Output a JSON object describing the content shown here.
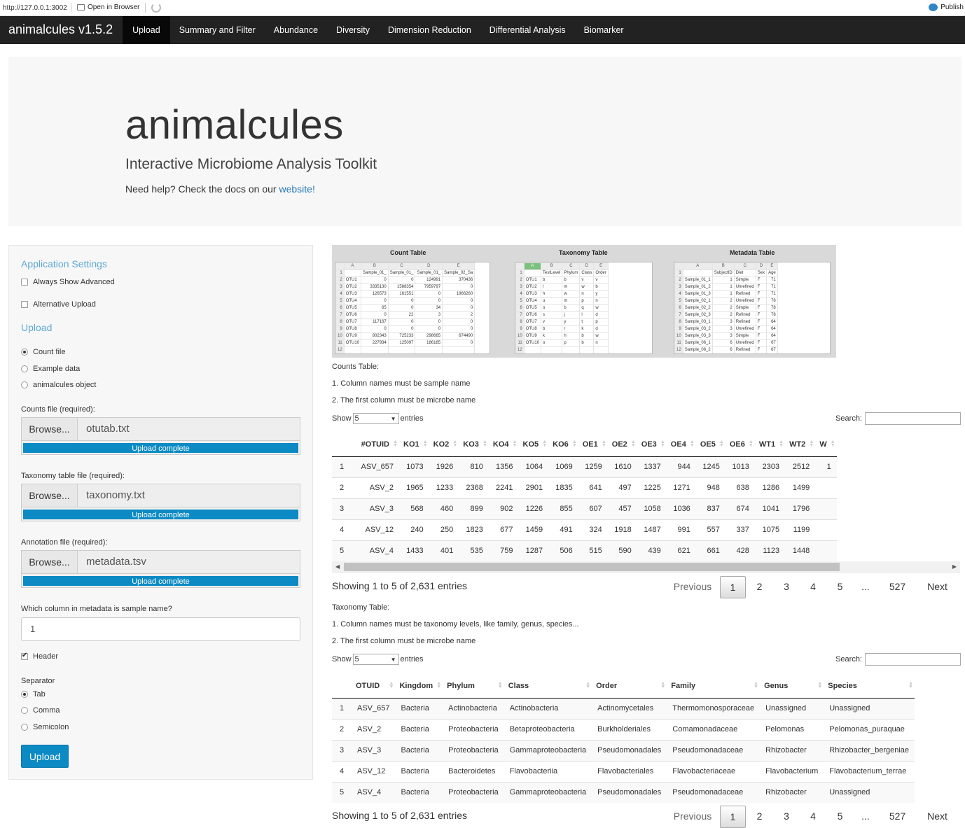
{
  "browser": {
    "url": "http://127.0.0.1:3002",
    "open_in_browser": "Open in Browser",
    "publish": "Publish"
  },
  "navbar": {
    "brand": "animalcules v1.5.2",
    "tabs": [
      "Upload",
      "Summary and Filter",
      "Abundance",
      "Diversity",
      "Dimension Reduction",
      "Differential Analysis",
      "Biomarker"
    ],
    "active_tab": "Upload"
  },
  "jumbotron": {
    "title": "animalcules",
    "subtitle": "Interactive Microbiome Analysis Toolkit",
    "help_text": "Need help? Check the docs on our",
    "help_link": "website!"
  },
  "sidebar": {
    "app_settings_title": "Application Settings",
    "always_show_advanced": "Always Show Advanced",
    "alternative_upload": "Alternative Upload",
    "upload_title": "Upload",
    "radio_options": [
      "Count file",
      "Example data",
      "animalcules object"
    ],
    "selected_radio": "Count file",
    "counts_label": "Counts file (required):",
    "counts_file": "otutab.txt",
    "taxonomy_label": "Taxonomy table file (required):",
    "taxonomy_file": "taxonomy.txt",
    "annotation_label": "Annotation file (required):",
    "annotation_file": "metadata.tsv",
    "browse_label": "Browse...",
    "upload_status": "Upload complete",
    "upload_progress": 1.0,
    "sample_col_label": "Which column in metadata is sample name?",
    "sample_col_value": "1",
    "header_label": "Header",
    "header_checked": true,
    "separator_label": "Separator",
    "separator_options": [
      "Tab",
      "Comma",
      "Semicolon"
    ],
    "selected_separator": "Tab",
    "upload_button": "Upload"
  },
  "example_image": {
    "count_title": "Count Table",
    "taxonomy_title": "Taxonomy Table",
    "metadata_title": "Metadata Table",
    "count_cols": [
      "A",
      "B",
      "C",
      "D",
      "E"
    ],
    "count_rows": [
      [
        "1",
        "",
        "Sample_01_",
        "Sample_01_",
        "Sample_01_",
        "Sample_02_Sa"
      ],
      [
        "2",
        "OTU1",
        "0",
        "0",
        "124991",
        "370436"
      ],
      [
        "3",
        "OTU2",
        "3335130",
        "1588354",
        "7959797",
        "0"
      ],
      [
        "4",
        "OTU3",
        "126573",
        "161551",
        "0",
        "1966260"
      ],
      [
        "5",
        "OTU4",
        "0",
        "0",
        "0",
        "0"
      ],
      [
        "6",
        "OTU5",
        "65",
        "0",
        "34",
        "0"
      ],
      [
        "7",
        "OTU6",
        "0",
        "22",
        "3",
        "2"
      ],
      [
        "8",
        "OTU7",
        "117167",
        "0",
        "0",
        "0"
      ],
      [
        "9",
        "OTU8",
        "0",
        "0",
        "0",
        "0"
      ],
      [
        "10",
        "OTU9",
        "802343",
        "725233",
        "298665",
        "674490"
      ],
      [
        "11",
        "OTU10",
        "227934",
        "125097",
        "186185",
        "0"
      ],
      [
        "12",
        "",
        "",
        "",
        "",
        ""
      ]
    ],
    "tax_cols": [
      "A",
      "B",
      "C",
      "D",
      "E"
    ],
    "tax_rows": [
      [
        "1",
        "",
        "TestLevel",
        "Phylum",
        "Class",
        "Order"
      ],
      [
        "2",
        "OTU1",
        "b",
        "b",
        "v",
        "v"
      ],
      [
        "3",
        "OTU2",
        "l",
        "m",
        "w",
        "b"
      ],
      [
        "4",
        "OTU3",
        "h",
        "w",
        "n",
        "y"
      ],
      [
        "5",
        "OTU4",
        "u",
        "m",
        "p",
        "n"
      ],
      [
        "6",
        "OTU5",
        "o",
        "b",
        "q",
        "w"
      ],
      [
        "7",
        "OTU6",
        "s",
        "j",
        "l",
        "d"
      ],
      [
        "8",
        "OTU7",
        "v",
        "y",
        "t",
        "p"
      ],
      [
        "9",
        "OTU8",
        "b",
        "r",
        "k",
        "d"
      ],
      [
        "10",
        "OTU9",
        "k",
        "h",
        "b",
        "w"
      ],
      [
        "11",
        "OTU10",
        "o",
        "p",
        "b",
        "n"
      ],
      [
        "12",
        "",
        "",
        "",
        "",
        ""
      ]
    ],
    "meta_cols": [
      "A",
      "B",
      "C",
      "D",
      "E"
    ],
    "meta_rows": [
      [
        "1",
        "",
        "SubjectID",
        "Diet",
        "Sex",
        "Age"
      ],
      [
        "2",
        "Sample_01_1",
        "1",
        "Simple",
        "F",
        "71"
      ],
      [
        "3",
        "Sample_01_2",
        "1",
        "Unrefined",
        "F",
        "71"
      ],
      [
        "4",
        "Sample_01_3",
        "1",
        "Refined",
        "F",
        "71"
      ],
      [
        "5",
        "Sample_02_1",
        "2",
        "Unrefined",
        "F",
        "78"
      ],
      [
        "6",
        "Sample_02_2",
        "2",
        "Simple",
        "F",
        "78"
      ],
      [
        "7",
        "Sample_02_3",
        "2",
        "Refined",
        "F",
        "78"
      ],
      [
        "8",
        "Sample_03_1",
        "3",
        "Refined",
        "F",
        "64"
      ],
      [
        "9",
        "Sample_03_2",
        "3",
        "Unrefined",
        "F",
        "64"
      ],
      [
        "10",
        "Sample_03_3",
        "3",
        "Simple",
        "F",
        "64"
      ],
      [
        "11",
        "Sample_06_1",
        "6",
        "Unrefined",
        "F",
        "67"
      ],
      [
        "12",
        "Sample_06_2",
        "6",
        "Refined",
        "F",
        "67"
      ]
    ]
  },
  "counts_notes": [
    "Counts Table:",
    "1. Column names must be sample name",
    "2. The first column must be microbe name"
  ],
  "taxonomy_notes": [
    "Taxonomy Table:",
    "1. Column names must be taxonomy levels, like family, genus, species...",
    "2. The first column must be microbe name"
  ],
  "show_label": "Show",
  "show_value": "5",
  "entries_label": "entries",
  "search_label": "Search:",
  "counts_table": {
    "headers": [
      "",
      "#OTUID",
      "KO1",
      "KO2",
      "KO3",
      "KO4",
      "KO5",
      "KO6",
      "OE1",
      "OE2",
      "OE3",
      "OE4",
      "OE5",
      "OE6",
      "WT1",
      "WT2",
      "W"
    ],
    "rows": [
      [
        "1",
        "ASV_657",
        "1073",
        "1926",
        "810",
        "1356",
        "1064",
        "1069",
        "1259",
        "1610",
        "1337",
        "944",
        "1245",
        "1013",
        "2303",
        "2512",
        "1"
      ],
      [
        "2",
        "ASV_2",
        "1965",
        "1233",
        "2368",
        "2241",
        "2901",
        "1835",
        "641",
        "497",
        "1225",
        "1271",
        "948",
        "638",
        "1286",
        "1499",
        ""
      ],
      [
        "3",
        "ASV_3",
        "568",
        "460",
        "899",
        "902",
        "1226",
        "855",
        "607",
        "457",
        "1058",
        "1036",
        "837",
        "674",
        "1041",
        "1796",
        ""
      ],
      [
        "4",
        "ASV_12",
        "240",
        "250",
        "1823",
        "677",
        "1459",
        "491",
        "324",
        "1918",
        "1487",
        "991",
        "557",
        "337",
        "1075",
        "1199",
        ""
      ],
      [
        "5",
        "ASV_4",
        "1433",
        "401",
        "535",
        "759",
        "1287",
        "506",
        "515",
        "590",
        "439",
        "621",
        "661",
        "428",
        "1123",
        "1448",
        ""
      ]
    ]
  },
  "taxonomy_table": {
    "headers": [
      "",
      "OTUID",
      "Kingdom",
      "Phylum",
      "Class",
      "Order",
      "Family",
      "Genus",
      "Species"
    ],
    "rows": [
      [
        "1",
        "ASV_657",
        "Bacteria",
        "Actinobacteria",
        "Actinobacteria",
        "Actinomycetales",
        "Thermomonosporaceae",
        "Unassigned",
        "Unassigned"
      ],
      [
        "2",
        "ASV_2",
        "Bacteria",
        "Proteobacteria",
        "Betaproteobacteria",
        "Burkholderiales",
        "Comamonadaceae",
        "Pelomonas",
        "Pelomonas_puraquae"
      ],
      [
        "3",
        "ASV_3",
        "Bacteria",
        "Proteobacteria",
        "Gammaproteobacteria",
        "Pseudomonadales",
        "Pseudomonadaceae",
        "Rhizobacter",
        "Rhizobacter_bergeniae"
      ],
      [
        "4",
        "ASV_12",
        "Bacteria",
        "Bacteroidetes",
        "Flavobacteriia",
        "Flavobacteriales",
        "Flavobacteriaceae",
        "Flavobacterium",
        "Flavobacterium_terrae"
      ],
      [
        "5",
        "ASV_4",
        "Bacteria",
        "Proteobacteria",
        "Gammaproteobacteria",
        "Pseudomonadales",
        "Pseudomonadaceae",
        "Rhizobacter",
        "Unassigned"
      ]
    ]
  },
  "table_info": "Showing 1 to 5 of 2,631 entries",
  "pagination": [
    "Previous",
    "1",
    "2",
    "3",
    "4",
    "5",
    "...",
    "527",
    "Next"
  ],
  "colors": {
    "navbar": "#222222",
    "accent": "#0b8ac4",
    "link": "#2a7ab9",
    "section_title": "#5ea9d6"
  }
}
